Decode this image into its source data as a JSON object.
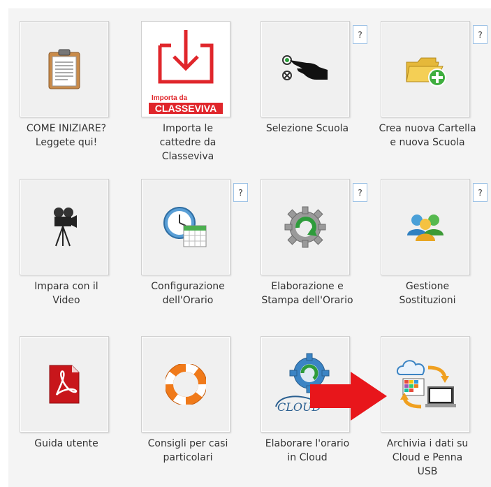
{
  "tiles": [
    {
      "label": "COME INIZIARE?\nLeggete qui!",
      "icon": "clipboard-icon"
    },
    {
      "label": "Importa le\ncattedre da\nClasseviva",
      "icon": "classeviva-import-icon",
      "badge_line1": "Importa da",
      "badge_line2": "CLASSEVIVA"
    },
    {
      "label": "Selezione Scuola",
      "icon": "select-school-hand-icon",
      "help": "?"
    },
    {
      "label": "Crea nuova Cartella\ne nuova Scuola",
      "icon": "new-folder-icon",
      "help": "?"
    },
    {
      "label": "Impara con il\nVideo",
      "icon": "movie-camera-icon"
    },
    {
      "label": "Configurazione\ndell'Orario",
      "icon": "clock-calendar-icon",
      "help": "?"
    },
    {
      "label": "Elaborazione e\nStampa dell'Orario",
      "icon": "gear-refresh-icon",
      "help": "?"
    },
    {
      "label": "Gestione\nSostituzioni",
      "icon": "users-icon",
      "help": "?"
    },
    {
      "label": "Guida utente",
      "icon": "pdf-icon"
    },
    {
      "label": "Consigli per casi\nparticolari",
      "icon": "lifebuoy-icon"
    },
    {
      "label": "Elaborare l'orario\nin Cloud",
      "icon": "cloud-gear-icon",
      "cloud_text": "CLOUD"
    },
    {
      "label": "Archivia i dati su\nCloud e Penna\nUSB",
      "icon": "cloud-usb-archive-icon"
    }
  ],
  "colors": {
    "classeviva_red": "#e0262b",
    "arrow_red": "#e8161b",
    "help_border": "#9fc3e6"
  }
}
